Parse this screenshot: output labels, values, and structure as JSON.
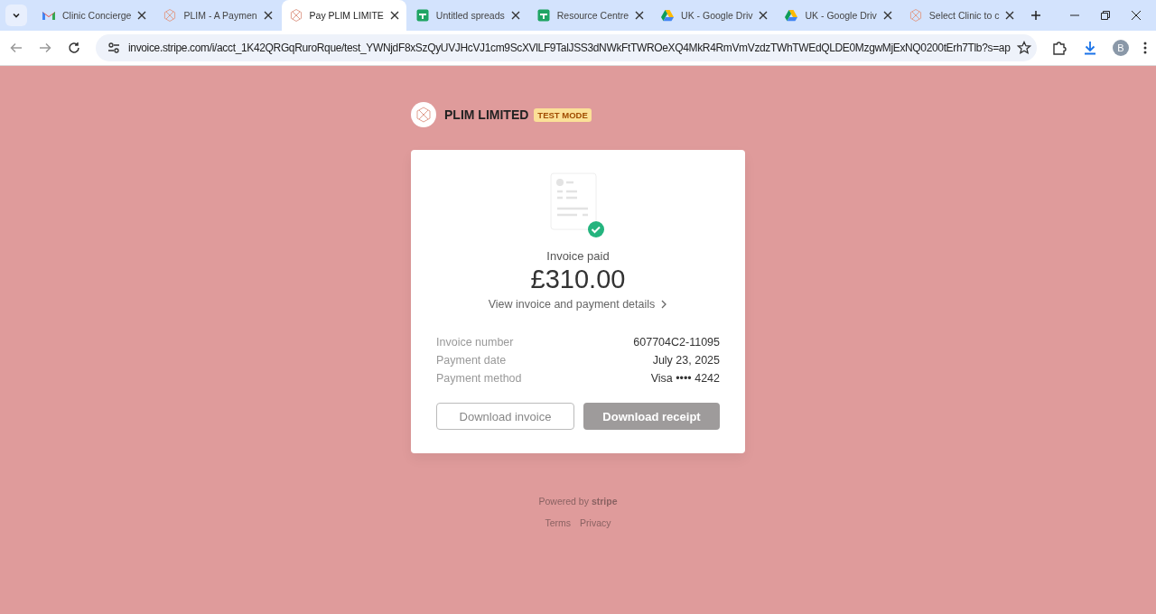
{
  "browser": {
    "tabs": [
      {
        "title": "Clinic Concierge",
        "kind": "mail",
        "selected": false
      },
      {
        "title": "PLIM - A Paymen",
        "kind": "plim",
        "selected": false
      },
      {
        "title": "Pay PLIM LIMITE",
        "kind": "plim",
        "selected": true
      },
      {
        "title": "Untitled spreads",
        "kind": "sheet",
        "selected": false
      },
      {
        "title": "Resource Centre",
        "kind": "sheet",
        "selected": false
      },
      {
        "title": "UK - Google Driv",
        "kind": "drive",
        "selected": false
      },
      {
        "title": "UK - Google Driv",
        "kind": "drive",
        "selected": false
      },
      {
        "title": "Select Clinic to c",
        "kind": "plim",
        "selected": false
      }
    ],
    "url": "invoice.stripe.com/i/acct_1K42QRGqRuroRque/test_YWNjdF8xSzQyUVJHcVJ1cm9ScXVlLF9TalJSS3dNWkFtTWROeXQ4MkR4RmVmVzdzTWhTWEdQLDE0MzgwMjExNQ0200tErh7Tlb?s=ap",
    "profile": "B"
  },
  "merchant": {
    "name": "PLIM LIMITED",
    "badge": "TEST MODE"
  },
  "invoice": {
    "status": "Invoice paid",
    "amount": "£310.00",
    "details_link": "View invoice and payment details",
    "fields": [
      {
        "label": "Invoice number",
        "value": "607704C2-11095"
      },
      {
        "label": "Payment date",
        "value": "July 23, 2025"
      },
      {
        "label": "Payment method",
        "value": "Visa •••• 4242"
      }
    ],
    "buttons": [
      {
        "label": "Download invoice",
        "kind": "secondary"
      },
      {
        "label": "Download receipt",
        "kind": "primary"
      }
    ]
  },
  "footer": {
    "powered": "Powered by **stripe**",
    "links": [
      "Terms",
      "Privacy"
    ]
  }
}
